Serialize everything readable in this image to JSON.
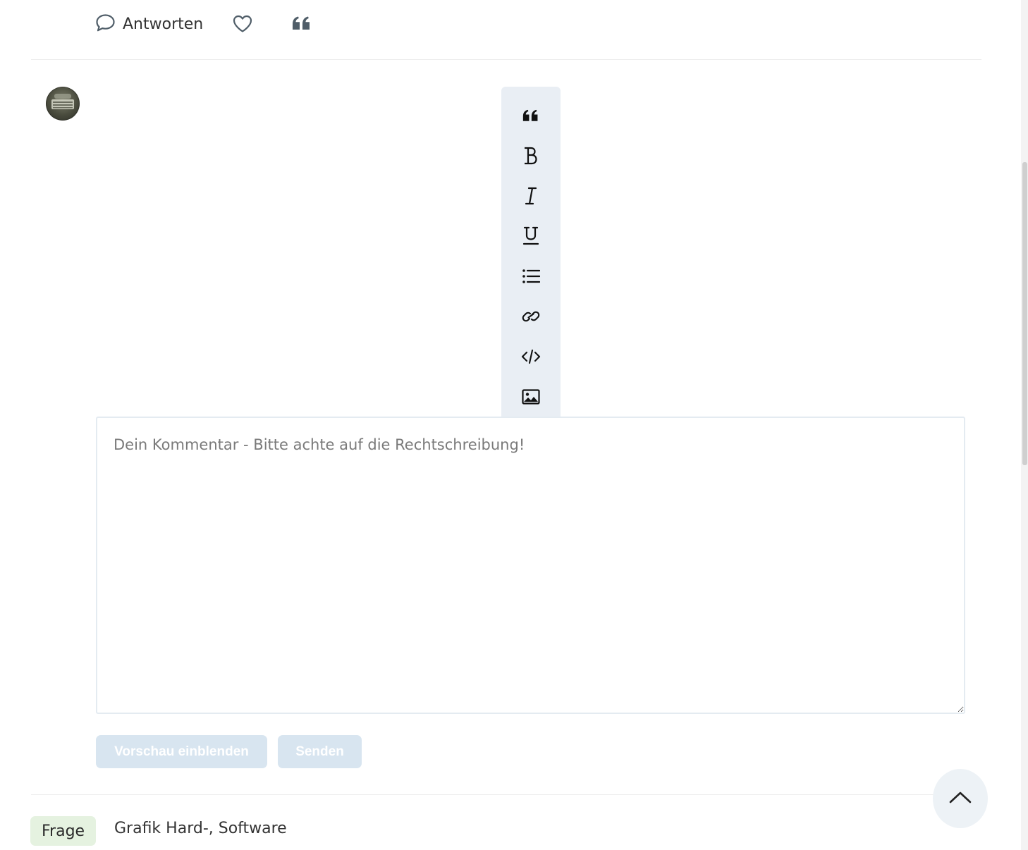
{
  "actions": {
    "reply_label": "Antworten"
  },
  "toolbar": {
    "items": [
      {
        "icon": "quote-icon",
        "label": "Zitat"
      },
      {
        "icon": "bold-icon",
        "label": "Fett"
      },
      {
        "icon": "italic-icon",
        "label": "Kursiv"
      },
      {
        "icon": "underline-icon",
        "label": "Unterstrichen"
      },
      {
        "icon": "list-icon",
        "label": "Liste"
      },
      {
        "icon": "link-icon",
        "label": "Link"
      },
      {
        "icon": "code-icon",
        "label": "Code"
      },
      {
        "icon": "image-icon",
        "label": "Bild"
      }
    ]
  },
  "comment": {
    "placeholder": "Dein Kommentar - Bitte achte auf die Rechtschreibung!",
    "value": ""
  },
  "buttons": {
    "preview_label": "Vorschau einblenden",
    "send_label": "Senden"
  },
  "tags": {
    "type_badge": "Frage",
    "category": "Grafik Hard-, Software"
  },
  "colors": {
    "toolbar_bg": "#e9eef4",
    "button_disabled_bg": "#d8e5f0",
    "badge_bg": "#e5f2e0",
    "icon_dark": "#4f5d68"
  }
}
